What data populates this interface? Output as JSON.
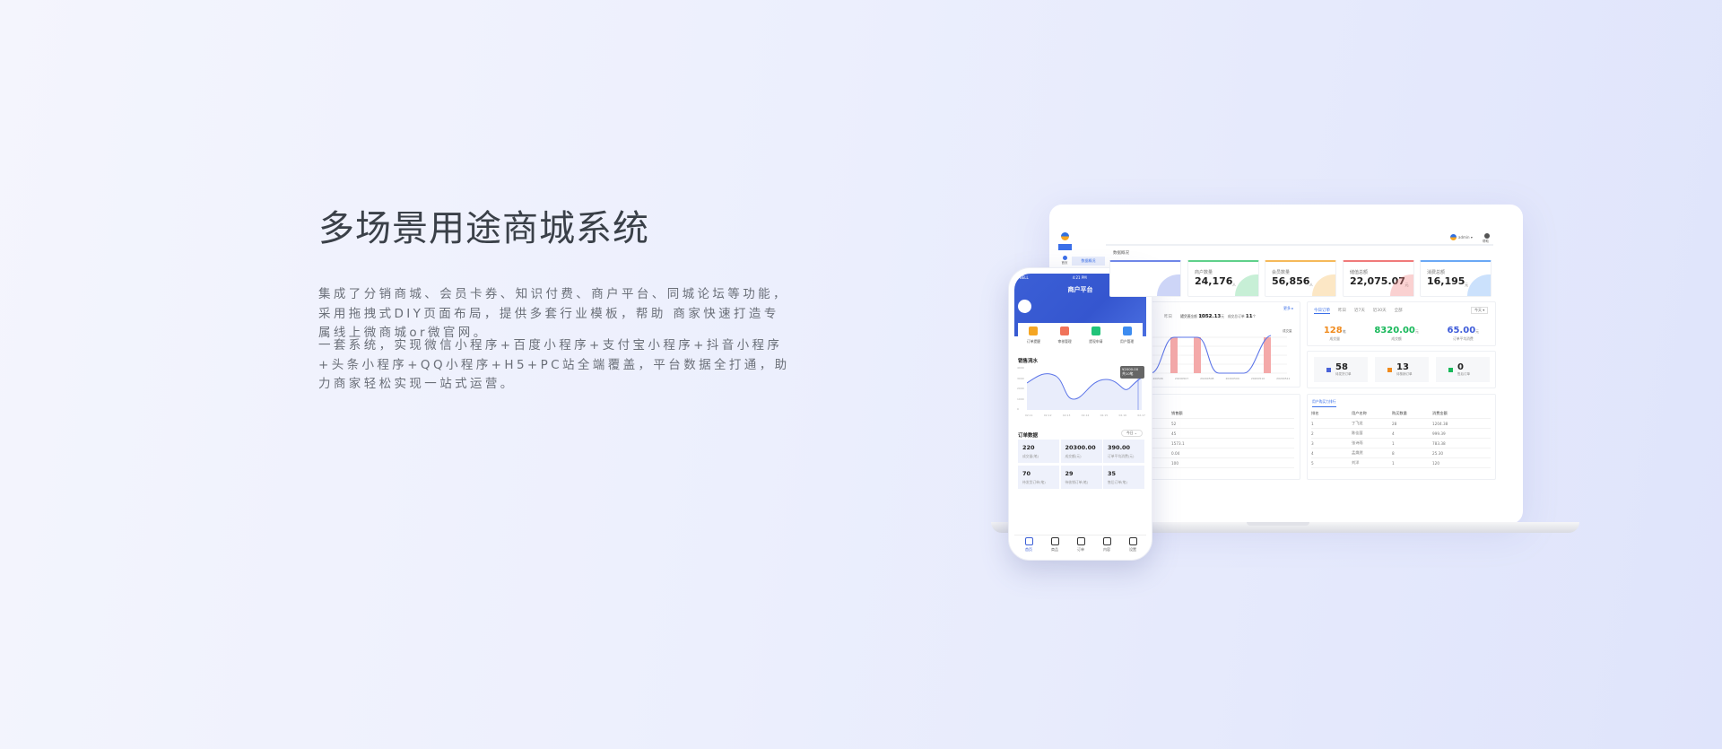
{
  "hero": {
    "title": "多场景用途商城系统",
    "paragraph1": "集成了分销商城、会员卡券、知识付费、商户平台、同城论坛等功能，采用拖拽式DIY页面布局，提供多套行业模板，帮助 商家快速打造专属线上微商城or微官网。",
    "paragraph2": "一套系统，实现微信小程序+百度小程序+支付宝小程序+抖音小程序+头条小程序+QQ小程序+H5+PC站全端覆盖，平台数据全打通，助力商家轻松实现一站式运营。"
  },
  "dashboard": {
    "sidebar": {
      "home": "首页",
      "sub_item": "数据概况"
    },
    "header": {
      "user": "admin",
      "help": "帮助"
    },
    "breadcrumb": "数据概况",
    "stats": [
      {
        "label": "",
        "value": "",
        "unit": "",
        "color": "#6f86e8"
      },
      {
        "label": "商户数量",
        "value": "24,176",
        "unit": "人",
        "color": "#5fd08a"
      },
      {
        "label": "会员数量",
        "value": "56,856",
        "unit": "人",
        "color": "#f5b95a"
      },
      {
        "label": "储值总额",
        "value": "22,075.07",
        "unit": "元",
        "color": "#f07a7a"
      },
      {
        "label": "消费总额",
        "value": "16,195",
        "unit": "元",
        "color": "#6aa8f5"
      }
    ],
    "chart_panel": {
      "tabs": [
        "昨日",
        "近7天",
        "近30天"
      ],
      "more": "更多 ▸",
      "summary_label1": "成交总金额",
      "summary_value1": "1052.13",
      "summary_unit1": "元",
      "summary_label2": "成交总订单",
      "summary_value2": "11",
      "summary_unit2": "个",
      "y_title": "成交量",
      "x_labels": [
        "20200506",
        "20200507",
        "20200508",
        "20200509",
        "20200510",
        "20200511"
      ]
    },
    "order_panel": {
      "tabs": [
        "今日订单",
        "昨日",
        "近7天",
        "近30天",
        "全部"
      ],
      "select": "今天",
      "metrics": [
        {
          "value": "128",
          "unit": "笔",
          "label": "成交量",
          "color": "#f08a1c"
        },
        {
          "value": "8320.00",
          "unit": "元",
          "label": "成交额",
          "color": "#18b85a"
        },
        {
          "value": "65.00",
          "unit": "元",
          "label": "订单平均消费",
          "color": "#3d5bd9"
        }
      ]
    },
    "order_status": [
      {
        "value": "58",
        "label": "待发货订单",
        "color": "#4a63d8"
      },
      {
        "value": "13",
        "label": "待核销订单",
        "color": "#f08a1c"
      },
      {
        "value": "0",
        "label": "售后订单",
        "color": "#18b85a"
      }
    ],
    "goods_table": {
      "columns": [
        "",
        "数量",
        "销售额"
      ],
      "rows": [
        [
          "卡通款拼装",
          "37",
          "52"
        ],
        [
          "",
          "29",
          "45"
        ],
        [
          "",
          "15",
          "1573.1"
        ],
        [
          "",
          "2",
          "0.04"
        ],
        [
          "男款夏季运动休闲透气跑步鞋",
          "1",
          "100"
        ]
      ]
    },
    "user_rank": {
      "tab": "用户购买力排行",
      "columns": [
        "排名",
        "用户名称",
        "购买数量",
        "消费金额"
      ],
      "rows": [
        [
          "1",
          "丁飞龙",
          "28",
          "1204.38"
        ],
        [
          "2",
          "陈佳茵",
          "4",
          "999.39"
        ],
        [
          "3",
          "张诗雨",
          "1",
          "783.38"
        ],
        [
          "4",
          "孟焕然",
          "8",
          "25.30"
        ],
        [
          "5",
          "刘洋",
          "1",
          "120"
        ]
      ]
    }
  },
  "phone": {
    "status_left": "BELL",
    "status_time": "4:21 PM",
    "status_battery": "100%",
    "title": "商户平台",
    "quick_actions": [
      "订单提醒",
      "审核管理",
      "提现申请",
      "用户管理"
    ],
    "sales_title": "销售流水",
    "tooltip_amount": "¥2000.00",
    "tooltip_count": "共10笔",
    "y_ticks": [
      "4000",
      "3000",
      "2000",
      "1000",
      "0"
    ],
    "x_ticks": [
      "02.11",
      "02.12",
      "02.13",
      "02.14",
      "02.15",
      "02.16",
      "02.17"
    ],
    "orders_title": "订单数据",
    "orders_filter": "今日",
    "order_grid": [
      {
        "value": "220",
        "label": "成交量(笔)"
      },
      {
        "value": "20300.00",
        "label": "成交额(元)"
      },
      {
        "value": "390.00",
        "label": "订单平均消费(元)"
      },
      {
        "value": "70",
        "label": "待发货订单(笔)"
      },
      {
        "value": "29",
        "label": "待核销订单(笔)"
      },
      {
        "value": "35",
        "label": "售后订单(笔)"
      }
    ],
    "tabbar": [
      "首页",
      "商品",
      "订单",
      "内容",
      "设置"
    ],
    "accent": "#3b5fd6"
  }
}
